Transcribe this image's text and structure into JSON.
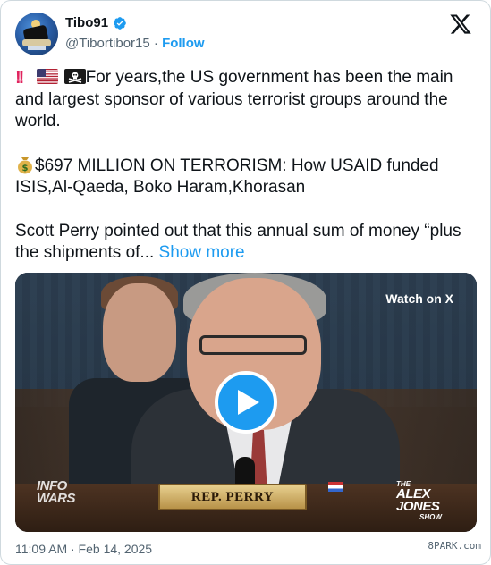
{
  "author": {
    "display_name": "Tibo91",
    "handle": "@Tibortibor15",
    "separator": "·",
    "follow_label": "Follow",
    "verified": true,
    "avatar_icon": "avatar-image"
  },
  "platform": {
    "logo_icon": "x-logo-icon",
    "brand_color": "#1d9bf0"
  },
  "tweet": {
    "line1_emojis": [
      "double-exclamation-icon",
      "us-flag-icon",
      "pirate-flag-icon"
    ],
    "paragraph1_text": "For years,the US government has been the main and largest sponsor of various terrorist groups around the world.",
    "paragraph2_emoji": "money-bag-icon",
    "paragraph2_text": "$697 MILLION ON TERRORISM: How USAID funded ISIS,Al-Qaeda, Boko Haram,Khorasan",
    "paragraph3_text": "Scott Perry pointed out that this annual sum of money “plus the shipments of...",
    "show_more_label": "Show more"
  },
  "media": {
    "watch_label": "Watch on X",
    "nameplate_text": "REP. PERRY",
    "infowars_logo_text": [
      "INFO",
      "WARS"
    ],
    "show_logo": {
      "the": "THE",
      "line1": "ALEX",
      "line2": "JONES",
      "line3": "SHOW"
    },
    "play_icon": "play-icon"
  },
  "footer": {
    "timestamp": "11:09 AM · Feb 14, 2025",
    "watermark": "8PARK.com"
  }
}
